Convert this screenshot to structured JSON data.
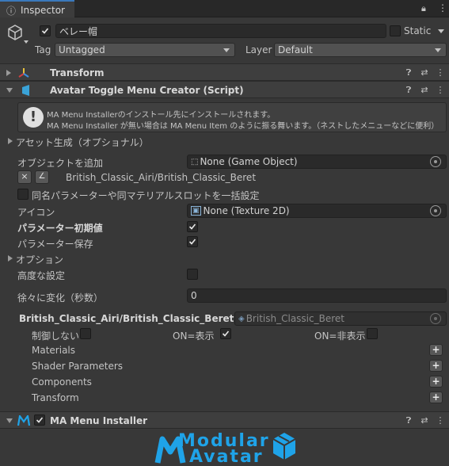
{
  "window": {
    "tab_label": "Inspector"
  },
  "gameobject": {
    "active": true,
    "name": "ベレー帽",
    "static_label": "Static",
    "tag_label": "Tag",
    "tag_value": "Untagged",
    "layer_label": "Layer",
    "layer_value": "Default"
  },
  "transform": {
    "title": "Transform"
  },
  "script": {
    "title": "Avatar Toggle Menu Creator (Script)",
    "info_line1": "MA Menu Installerのインストール先にインストールされます。",
    "info_line2": "MA Menu Installer が無い場合は MA Menu Item のように振る舞います。（ネストしたメニューなどに便利）",
    "asset_gen_label": "アセット生成（オプショナル）",
    "add_object_label": "オブジェクトを追加",
    "add_object_value": "None (Game Object)",
    "remove_btn": "×",
    "edit_btn": "∠",
    "path_label": "British_Classic_Airi/British_Classic_Beret",
    "same_name_label": "同名パラメーターや同マテリアルスロットを一括設定",
    "icon_label": "アイコン",
    "icon_value": "None (Texture 2D)",
    "param_default_label": "パラメーター初期値",
    "param_save_label": "パラメーター保存",
    "options_label": "オプション",
    "advanced_label": "高度な設定",
    "transition_label": "徐々に変化（秒数）",
    "transition_value": "0",
    "target_label": "British_Classic_Airi/British_Classic_Beret",
    "target_value": "British_Classic_Beret",
    "no_control_label": "制御しない",
    "on_show_label": "ON=表示",
    "on_hide_label": "ON=非表示",
    "materials_label": "Materials",
    "shader_params_label": "Shader Parameters",
    "components_label": "Components",
    "transform_label": "Transform",
    "plus_label": "+"
  },
  "installer": {
    "title": "MA Menu Installer",
    "logo_line1": "Modular",
    "logo_line2": "Avatar"
  },
  "colors": {
    "accent": "#1e9fe0",
    "bg": "#383838",
    "header": "#3e3e3e",
    "logo": "#1fa3e8"
  },
  "icons": [
    "cube-icon",
    "transform-icon",
    "script-icon",
    "info-icon",
    "help-icon",
    "settings-icon",
    "more-icon",
    "lock-icon",
    "menu-icon",
    "object-picker-icon",
    "texture-icon",
    "ma-logo-icon"
  ]
}
